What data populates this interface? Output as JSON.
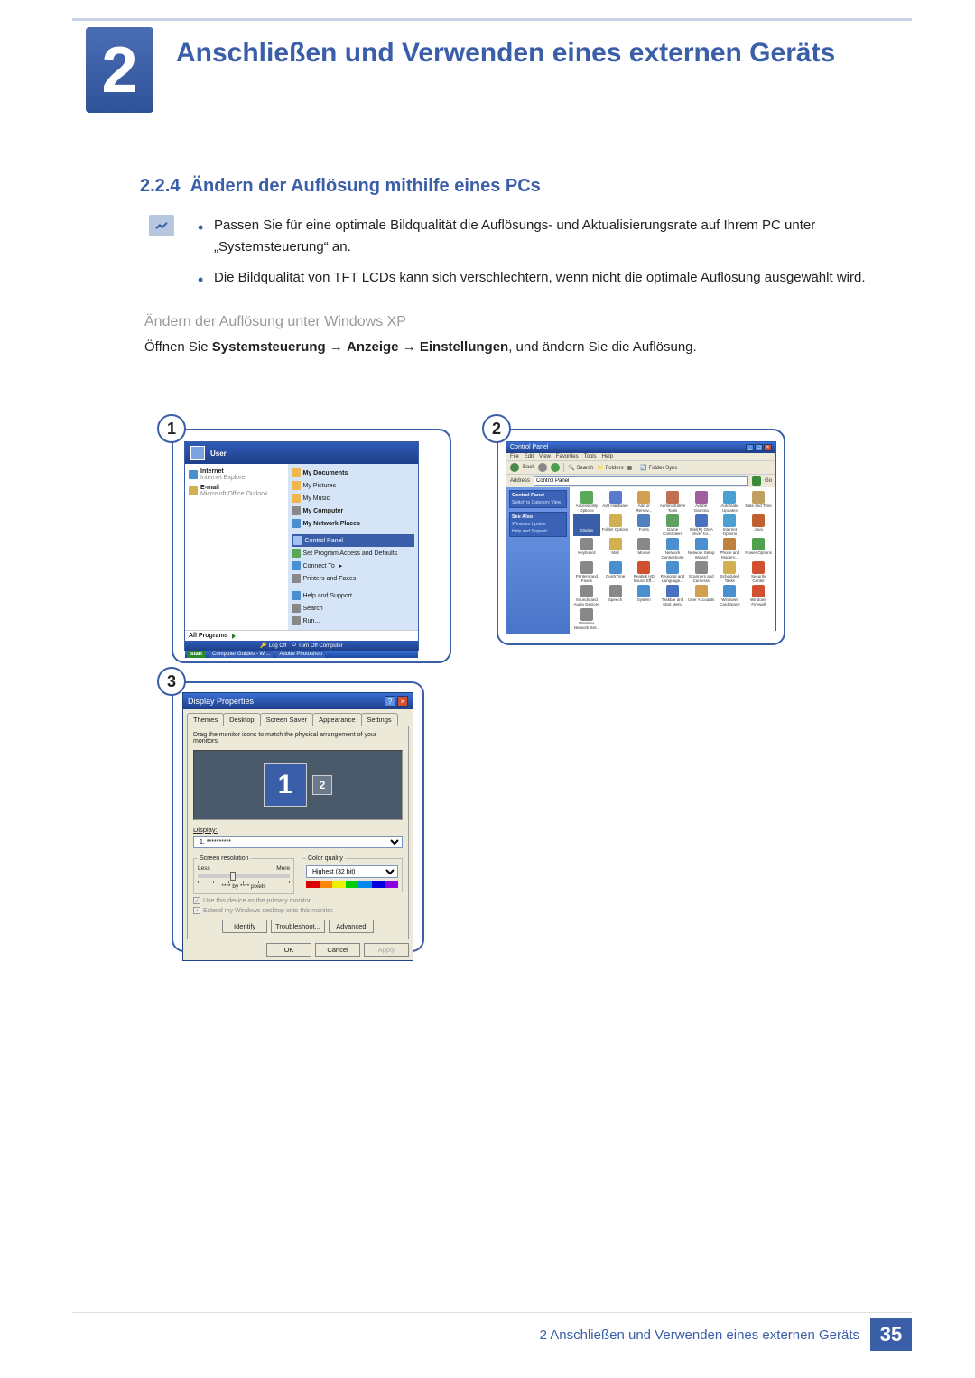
{
  "chapter": {
    "number": "2",
    "title": "Anschließen und Verwenden eines externen Geräts"
  },
  "section": {
    "number": "2.2.4",
    "title": "Ändern der Auflösung mithilfe eines PCs"
  },
  "notes": [
    "Passen Sie für eine optimale Bildqualität die Auflösungs- und Aktualisierungsrate auf Ihrem PC unter „Systemsteuerung“ an.",
    "Die Bildqualität von TFT LCDs kann sich verschlechtern, wenn nicht die optimale Auflösung ausgewählt wird."
  ],
  "subheading": "Ändern der Auflösung unter Windows XP",
  "instruction": {
    "prefix": "Öffnen Sie ",
    "path1": "Systemsteuerung",
    "path2": "Anzeige",
    "path3": "Einstellungen",
    "suffix": ", und ändern Sie die Auflösung."
  },
  "fig1": {
    "badge": "1",
    "user": "User",
    "left": {
      "internet": "Internet",
      "internet_sub": "Internet Explorer",
      "email": "E-mail",
      "email_sub": "Microsoft Office Outlook"
    },
    "right": [
      "My Documents",
      "My Pictures",
      "My Music",
      "My Computer",
      "My Network Places",
      "Control Panel",
      "Set Program Access and Defaults",
      "Connect To",
      "Printers and Faxes",
      "Help and Support",
      "Search",
      "Run..."
    ],
    "all_programs": "All Programs",
    "logoff": "Log Off",
    "turnoff": "Turn Off Computer",
    "taskbar": {
      "start": "start",
      "apps": [
        "Computer Guides - Wi...",
        "Adobe Photoshop"
      ]
    }
  },
  "fig2": {
    "badge": "2",
    "title": "Control Panel",
    "menubar": [
      "File",
      "Edit",
      "View",
      "Favorites",
      "Tools",
      "Help"
    ],
    "toolbar": {
      "back": "Back",
      "search": "Search",
      "folders": "Folders",
      "foldersync": "Folder Sync"
    },
    "address_label": "Address",
    "address_value": "Control Panel",
    "go": "Go",
    "side": {
      "box1_title": "Control Panel",
      "box1_link": "Switch to Category View",
      "box2_title": "See Also",
      "box2_link1": "Windows Update",
      "box2_link2": "Help and Support"
    },
    "icons": [
      {
        "label": "Accessibility Options",
        "c": "#5aa85a"
      },
      {
        "label": "Add Hardware",
        "c": "#5a7ad0"
      },
      {
        "label": "Add or Remov...",
        "c": "#d0a050"
      },
      {
        "label": "Administrative Tools",
        "c": "#c07050"
      },
      {
        "label": "Adobe Gamma",
        "c": "#a060a0"
      },
      {
        "label": "Automatic Updates",
        "c": "#4aa0d0"
      },
      {
        "label": "Date and Time",
        "c": "#c0a060"
      },
      {
        "label": "Display",
        "c": "#3a5ea8",
        "sel": true
      },
      {
        "label": "Folder Options",
        "c": "#d0b050"
      },
      {
        "label": "Fonts",
        "c": "#5080c0"
      },
      {
        "label": "Game Controllers",
        "c": "#60a060"
      },
      {
        "label": "Intel(R) GMA Driver for...",
        "c": "#4a70c0"
      },
      {
        "label": "Internet Options",
        "c": "#4aa0d0"
      },
      {
        "label": "Java",
        "c": "#c06030"
      },
      {
        "label": "Keyboard",
        "c": "#888"
      },
      {
        "label": "Mail",
        "c": "#d0b050"
      },
      {
        "label": "Mouse",
        "c": "#888"
      },
      {
        "label": "Network Connections",
        "c": "#4a90d0"
      },
      {
        "label": "Network Setup Wizard",
        "c": "#4a90d0"
      },
      {
        "label": "Phone and Modem...",
        "c": "#c08040"
      },
      {
        "label": "Power Options",
        "c": "#50a050"
      },
      {
        "label": "Printers and Faxes",
        "c": "#888"
      },
      {
        "label": "QuickTime",
        "c": "#4a90d0"
      },
      {
        "label": "Realtek HD Sound Eff...",
        "c": "#d05030"
      },
      {
        "label": "Regional and Language...",
        "c": "#4a90d0"
      },
      {
        "label": "Scanners and Cameras",
        "c": "#888"
      },
      {
        "label": "Scheduled Tasks",
        "c": "#d0b050"
      },
      {
        "label": "Security Center",
        "c": "#d05030"
      },
      {
        "label": "Sounds and Audio Devices",
        "c": "#888"
      },
      {
        "label": "Speech",
        "c": "#888"
      },
      {
        "label": "System",
        "c": "#4a90d0"
      },
      {
        "label": "Taskbar and Start Menu",
        "c": "#4a70c0"
      },
      {
        "label": "User Accounts",
        "c": "#d0a050"
      },
      {
        "label": "Windows CardSpace",
        "c": "#4a90d0"
      },
      {
        "label": "Windows Firewall",
        "c": "#d05030"
      },
      {
        "label": "Wireless Network Set...",
        "c": "#888"
      }
    ]
  },
  "fig3": {
    "badge": "3",
    "title": "Display Properties",
    "tabs": [
      "Themes",
      "Desktop",
      "Screen Saver",
      "Appearance",
      "Settings"
    ],
    "active_tab": 4,
    "hint": "Drag the monitor icons to match the physical arrangement of your monitors.",
    "monitors": {
      "m1": "1",
      "m2": "2"
    },
    "display_label": "Display:",
    "display_value": "1. **********",
    "screen_res_legend": "Screen resolution",
    "less": "Less",
    "more": "More",
    "res_value": "**** by **** pixels",
    "color_legend": "Color quality",
    "color_value": "Highest (32 bit)",
    "chk1": "Use this device as the primary monitor.",
    "chk2": "Extend my Windows desktop onto this monitor.",
    "btn_identify": "Identify",
    "btn_troubleshoot": "Troubleshoot...",
    "btn_advanced": "Advanced",
    "btn_ok": "OK",
    "btn_cancel": "Cancel",
    "btn_apply": "Apply"
  },
  "footer": {
    "text": "2 Anschließen und Verwenden eines externen Geräts",
    "page": "35"
  }
}
